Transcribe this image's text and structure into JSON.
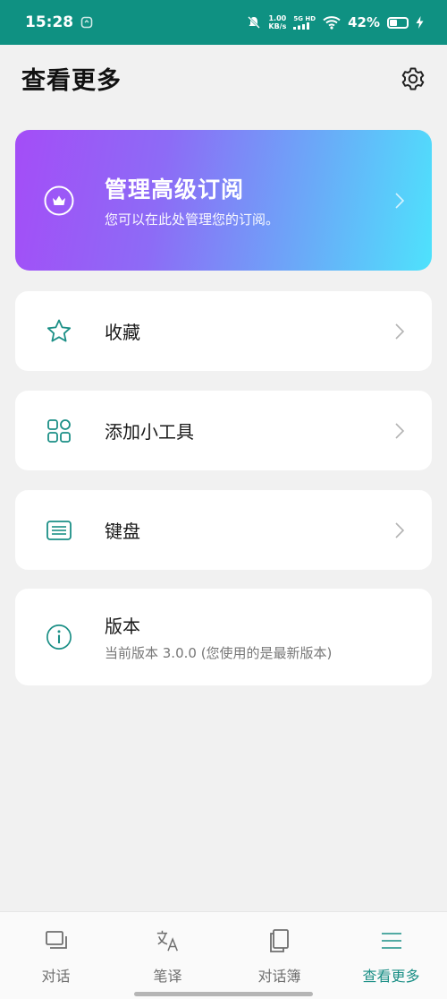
{
  "status_bar": {
    "time": "15:28",
    "net_speed_value": "1.00",
    "net_speed_unit": "KB/s",
    "net_type_top": "5G HD",
    "battery": "42%",
    "battery_level": 0.42
  },
  "header": {
    "title": "查看更多"
  },
  "premium": {
    "title": "管理高级订阅",
    "subtitle": "您可以在此处管理您的订阅。"
  },
  "menu": {
    "favorites": "收藏",
    "widgets": "添加小工具",
    "keyboard": "键盘"
  },
  "version": {
    "title": "版本",
    "subtitle": "当前版本 3.0.0 (您使用的是最新版本)"
  },
  "bottom_nav": {
    "items": [
      {
        "label": "对话",
        "icon": "chat-icon",
        "active": false
      },
      {
        "label": "笔译",
        "icon": "translate-icon",
        "active": false
      },
      {
        "label": "对话簿",
        "icon": "phrasebook-icon",
        "active": false
      },
      {
        "label": "查看更多",
        "icon": "menu-icon",
        "active": true
      }
    ]
  },
  "colors": {
    "status_bar": "#0f9182",
    "accent": "#1b8f86",
    "premium_gradient_start": "#a44df7",
    "premium_gradient_end": "#4ee2fc"
  }
}
